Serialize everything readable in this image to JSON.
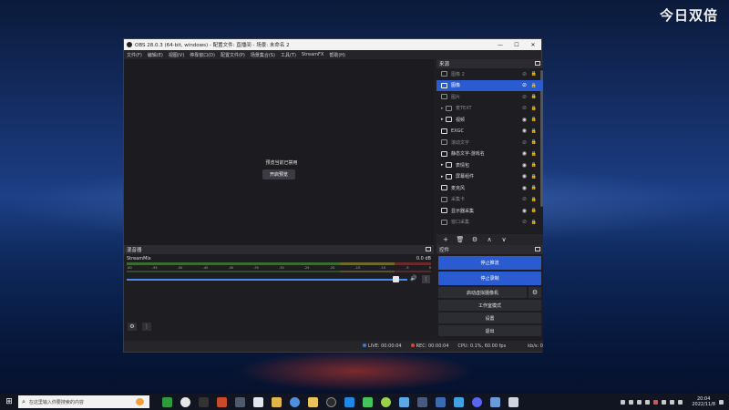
{
  "watermark": "今日双倍",
  "window": {
    "title": "OBS 28.0.3 (64-bit, windows) - 配置文件: 直播间 - 场景: 未命名 2",
    "controls": [
      "—",
      "☐",
      "✕"
    ]
  },
  "menu": [
    "文件(F)",
    "编辑(E)",
    "视图(V)",
    "停靠窗口(D)",
    "配置文件(P)",
    "场景集合(S)",
    "工具(T)",
    "StreamFX",
    "帮助(H)"
  ],
  "preview": {
    "message": "预览当前已禁用",
    "button": "开启预览"
  },
  "sources": {
    "title": "来源",
    "items": [
      {
        "label": "图像 2",
        "icon": "image-icon",
        "group": false,
        "visible": false,
        "selected": false
      },
      {
        "label": "图像",
        "icon": "image-icon",
        "group": false,
        "visible": false,
        "selected": true
      },
      {
        "label": "图片",
        "icon": "image-icon",
        "group": false,
        "visible": false,
        "selected": false
      },
      {
        "label": "麦TEXT",
        "icon": "folder-icon",
        "group": true,
        "visible": false,
        "selected": false
      },
      {
        "label": "视频",
        "icon": "folder-icon",
        "group": true,
        "visible": true,
        "selected": false
      },
      {
        "label": "EXGC",
        "icon": "browser-icon",
        "group": false,
        "visible": true,
        "selected": false
      },
      {
        "label": "滚动文字",
        "icon": "cloud-icon",
        "group": false,
        "visible": false,
        "selected": false
      },
      {
        "label": "静态文字-游戏名",
        "icon": "text-icon",
        "group": false,
        "visible": true,
        "selected": false
      },
      {
        "label": "表情包",
        "icon": "folder-icon",
        "group": true,
        "visible": true,
        "selected": false
      },
      {
        "label": "屏幕组件",
        "icon": "folder-icon",
        "group": true,
        "visible": true,
        "selected": false
      },
      {
        "label": "麦克风",
        "icon": "mic-icon",
        "group": false,
        "visible": true,
        "selected": false
      },
      {
        "label": "采集卡",
        "icon": "camera-icon",
        "group": false,
        "visible": false,
        "selected": false
      },
      {
        "label": "显示器采集",
        "icon": "monitor-icon",
        "group": false,
        "visible": true,
        "selected": false
      },
      {
        "label": "窗口采集",
        "icon": "window-icon",
        "group": false,
        "visible": false,
        "selected": false
      }
    ],
    "toolbar": [
      "+",
      "🗑",
      "⚙",
      "∧",
      "∨"
    ]
  },
  "mixer": {
    "title": "混音器",
    "channel": "StreamMix",
    "db": "0.0 dB",
    "scale": [
      "-60",
      "-55",
      "-50",
      "-45",
      "-40",
      "-35",
      "-30",
      "-25",
      "-20",
      "-15",
      "-10",
      "-5",
      "0"
    ],
    "volume_fraction": 0.97
  },
  "controls": {
    "title": "控件",
    "stop_stream": "停止推流",
    "stop_record": "停止录制",
    "virtual_cam": "启动虚拟摄像机",
    "studio_mode": "工作室模式",
    "settings": "设置",
    "exit": "退出"
  },
  "status": {
    "live": "LIVE: 00:00:04",
    "rec": "REC: 00:00:04",
    "cpu": "CPU: 0.1%, 60.00 fps",
    "kbps": "kb/s: 0"
  },
  "taskbar": {
    "search_placeholder": "在这里输入你要搜索的内容",
    "time": "20:04",
    "date": "2022/11/8"
  }
}
